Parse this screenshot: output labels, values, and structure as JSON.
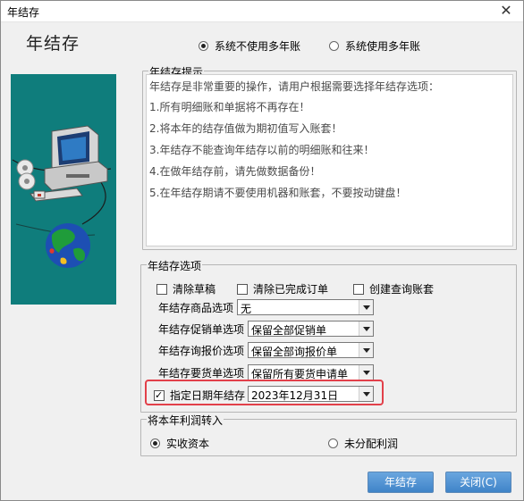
{
  "window": {
    "title": "年结存"
  },
  "header": {
    "heading": "年结存",
    "mode_options": [
      {
        "label": "系统不使用多年账",
        "selected": true
      },
      {
        "label": "系统使用多年账",
        "selected": false
      }
    ]
  },
  "tips": {
    "legend": "年结存提示",
    "lines": [
      "年结存是非常重要的操作，请用户根据需要选择年结存选项：",
      "1.所有明细账和单据将不再存在！",
      "2.将本年的结存值做为期初值写入账套！",
      "3.年结存不能查询年结存以前的明细账和往来！",
      "4.在做年结存前，请先做数据备份！",
      "5.在年结存期请不要使用机器和账套，不要按动键盘！"
    ]
  },
  "options": {
    "legend": "年结存选项",
    "checkboxes": [
      {
        "label": "清除草稿",
        "checked": false
      },
      {
        "label": "清除已完成订单",
        "checked": false
      },
      {
        "label": "创建查询账套",
        "checked": false
      }
    ],
    "selects": [
      {
        "label": "年结存商品选项",
        "value": "无"
      },
      {
        "label": "年结存促销单选项",
        "value": "保留全部促销单"
      },
      {
        "label": "年结存询报价选项",
        "value": "保留全部询报价单"
      },
      {
        "label": "年结存要货单选项",
        "value": "保留所有要货申请单"
      }
    ],
    "date": {
      "label": "指定日期年结存",
      "checked": true,
      "value": "2023年12月31日"
    }
  },
  "profit": {
    "legend": "将本年利润转入",
    "options": [
      {
        "label": "实收资本",
        "selected": true
      },
      {
        "label": "未分配利润",
        "selected": false
      }
    ]
  },
  "buttons": {
    "ok": "年结存",
    "close": "关闭(C)"
  },
  "colors": {
    "accent_button": "#3f84c8",
    "illustration_bg": "#0f7d7c",
    "highlight": "#e2404a"
  }
}
